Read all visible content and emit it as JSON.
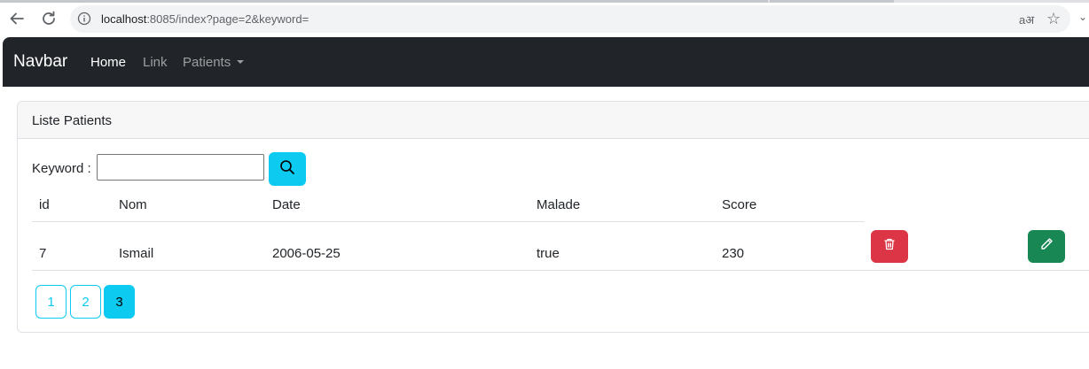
{
  "browser": {
    "url_host": "localhost",
    "url_rest": ":8085/index?page=2&keyword=",
    "translate_glyph": "aअ"
  },
  "navbar": {
    "brand": "Navbar",
    "links": [
      {
        "label": "Home",
        "active": true
      },
      {
        "label": "Link",
        "active": false
      },
      {
        "label": "Patients",
        "active": false,
        "dropdown": true
      }
    ]
  },
  "card": {
    "title": "Liste Patients",
    "search": {
      "label": "Keyword :",
      "value": "",
      "button_icon": "search-icon"
    },
    "table": {
      "columns": [
        "id",
        "Nom",
        "Date",
        "Malade",
        "Score"
      ],
      "rows": [
        {
          "id": "7",
          "nom": "Ismail",
          "date": "2006-05-25",
          "malade": "true",
          "score": "230",
          "delete_icon": "trash-icon",
          "edit_icon": "pencil-icon"
        }
      ]
    },
    "pagination": {
      "pages": [
        "1",
        "2",
        "3"
      ],
      "current_index": 2
    }
  },
  "colors": {
    "navbar_bg": "#212529",
    "info": "#0dcaf0",
    "danger": "#dc3545",
    "success": "#198754"
  }
}
